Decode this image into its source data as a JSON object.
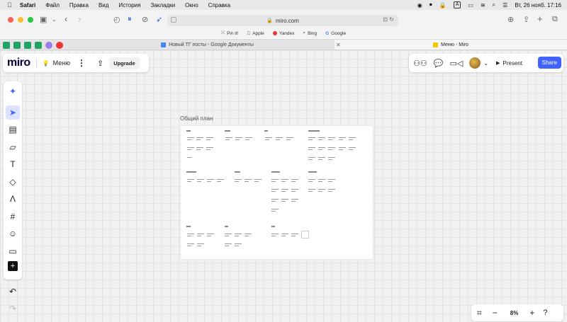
{
  "menubar": {
    "app": "Safari",
    "items": [
      "Файл",
      "Правка",
      "Вид",
      "История",
      "Закладки",
      "Окно",
      "Справка"
    ],
    "datetime": "Вт, 26 нояб.  17:16",
    "input_source": "A"
  },
  "browser": {
    "address": "miro.com",
    "favorites": [
      {
        "label": "Pin it!",
        "icon": "pin-icon"
      },
      {
        "label": "Apple",
        "icon": "apple-icon"
      },
      {
        "label": "Yandex",
        "icon": "yandex-icon"
      },
      {
        "label": "Bing",
        "icon": "bing-icon"
      },
      {
        "label": "Google",
        "icon": "google-icon"
      }
    ],
    "tabs": [
      {
        "label": "Новый ТГ посты - Google Документы",
        "active": false
      },
      {
        "label": "Меню - Miro",
        "active": true
      }
    ]
  },
  "miro": {
    "logo": "miro",
    "board_name": "Меню",
    "upgrade_label": "Upgrade",
    "present_label": "Present",
    "share_label": "Share",
    "zoom": "8%",
    "frame_title": "Общий план"
  },
  "colors": {
    "accent": "#4262ff",
    "traffic_red": "#ff5f57",
    "traffic_yellow": "#febc2e",
    "traffic_green": "#28c840"
  }
}
